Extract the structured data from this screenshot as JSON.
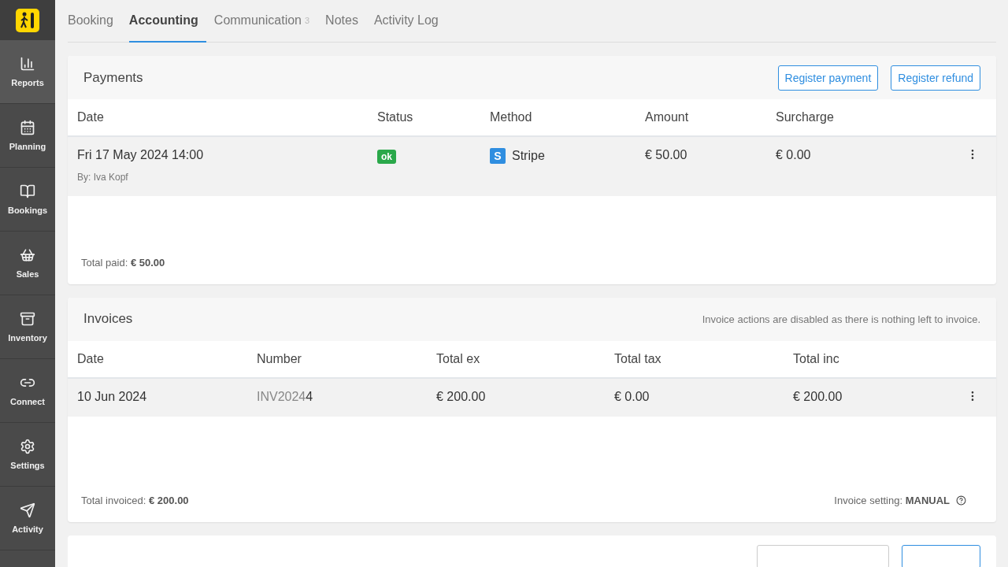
{
  "sidebar": {
    "items": [
      {
        "label": "Reports",
        "selected": true
      },
      {
        "label": "Planning",
        "selected": false
      },
      {
        "label": "Bookings",
        "selected": false
      },
      {
        "label": "Sales",
        "selected": false
      },
      {
        "label": "Inventory",
        "selected": false
      },
      {
        "label": "Connect",
        "selected": false
      },
      {
        "label": "Settings",
        "selected": false
      },
      {
        "label": "Activity",
        "selected": false
      }
    ]
  },
  "tabs": [
    {
      "label": "Booking",
      "selected": false
    },
    {
      "label": "Accounting",
      "selected": true
    },
    {
      "label": "Communication",
      "count": "3",
      "selected": false
    },
    {
      "label": "Notes",
      "selected": false
    },
    {
      "label": "Activity Log",
      "selected": false
    }
  ],
  "payments": {
    "title": "Payments",
    "buttons": [
      "Register payment",
      "Register refund"
    ],
    "columns": [
      "Date",
      "Status",
      "Method",
      "Amount",
      "Surcharge"
    ],
    "rows": [
      {
        "date": "Fri 17 May 2024 14:00",
        "by": "By: Iva Kopf",
        "status": "ok",
        "method": "Stripe",
        "method_icon": "S",
        "amount": "€ 50.00",
        "surcharge": "€ 0.00"
      }
    ],
    "total": "Total paid: **€ 50.00**"
  },
  "invoices": {
    "title": "Invoices",
    "notice": "Invoice actions are disabled as there is nothing left to invoice.",
    "columns": [
      "Date",
      "Number",
      "Total ex",
      "Total tax",
      "Total inc"
    ],
    "rows": [
      {
        "date": "10 Jun 2024",
        "number_prefix": "INV2024",
        "number_suffix": "4",
        "total_ex": "€ 200.00",
        "total_tax": "€ 0.00",
        "total_inc": "€ 200.00"
      }
    ],
    "total": "Total invoiced: **€ 200.00**",
    "setting": "Invoice setting: **MANUAL**"
  }
}
